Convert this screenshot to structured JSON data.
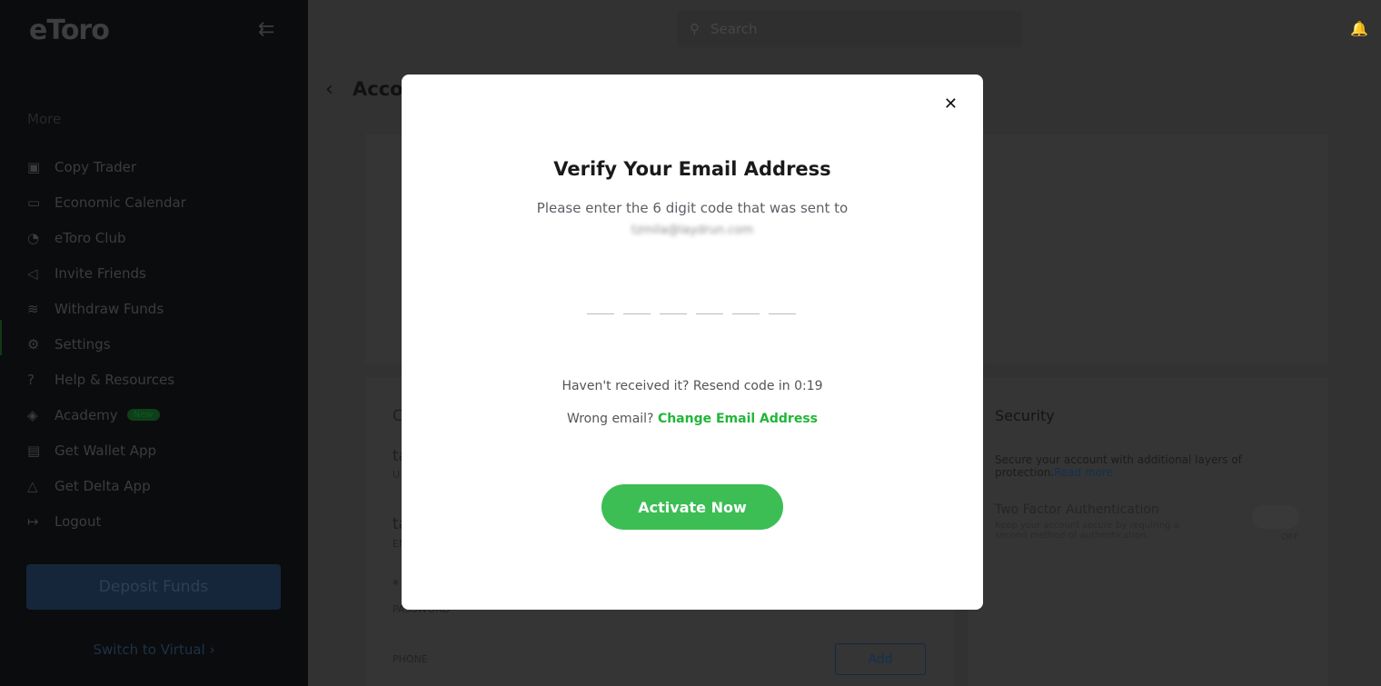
{
  "sidebar": {
    "logo": "eToro",
    "section": "More",
    "items": [
      {
        "label": "Copy Trader",
        "icon": "copy-trader-icon",
        "glyph": "▣"
      },
      {
        "label": "Economic Calendar",
        "icon": "calendar-icon",
        "glyph": "▭"
      },
      {
        "label": "eToro Club",
        "icon": "club-icon",
        "glyph": "◔"
      },
      {
        "label": "Invite Friends",
        "icon": "megaphone-icon",
        "glyph": "◁"
      },
      {
        "label": "Withdraw Funds",
        "icon": "coins-icon",
        "glyph": "≋"
      },
      {
        "label": "Settings",
        "icon": "gear-icon",
        "glyph": "⚙"
      },
      {
        "label": "Help & Resources",
        "icon": "help-icon",
        "glyph": "?"
      },
      {
        "label": "Academy",
        "icon": "academy-icon",
        "glyph": "◈",
        "badge": "New"
      },
      {
        "label": "Get Wallet App",
        "icon": "wallet-icon",
        "glyph": "▤"
      },
      {
        "label": "Get Delta App",
        "icon": "delta-icon",
        "glyph": "△"
      },
      {
        "label": "Logout",
        "icon": "logout-icon",
        "glyph": "↦"
      }
    ],
    "deposit": "Deposit Funds",
    "switch": "Switch to Virtual ›"
  },
  "header": {
    "search_placeholder": "Search"
  },
  "page": {
    "title": "Account",
    "card_heading": "C",
    "field1": "ta",
    "field1_label": "U",
    "field2": "ta",
    "field2_label": "EN",
    "password_value": "*",
    "password_label": "PASSWORD",
    "phone_label": "PHONE",
    "add": "Add",
    "security": {
      "title": "Security",
      "desc": "Secure your account with additional layers of protection.",
      "read_more": "Read more",
      "tfa_title": "Two Factor Authentication",
      "tfa_desc": "Keep your account secure by requiring a second method of authentication.",
      "toggle": "OFF"
    }
  },
  "modal": {
    "title": "Verify Your Email Address",
    "subtitle": "Please enter the 6 digit code that was sent to",
    "email": "tzmila@laydrun.com",
    "resend": "Haven't received it? Resend code in 0:19",
    "wrong": "Wrong email?",
    "change": "Change Email Address",
    "activate": "Activate Now",
    "code_length": 6
  },
  "colors": {
    "accent": "#3cbe55",
    "link": "#23b53a"
  }
}
